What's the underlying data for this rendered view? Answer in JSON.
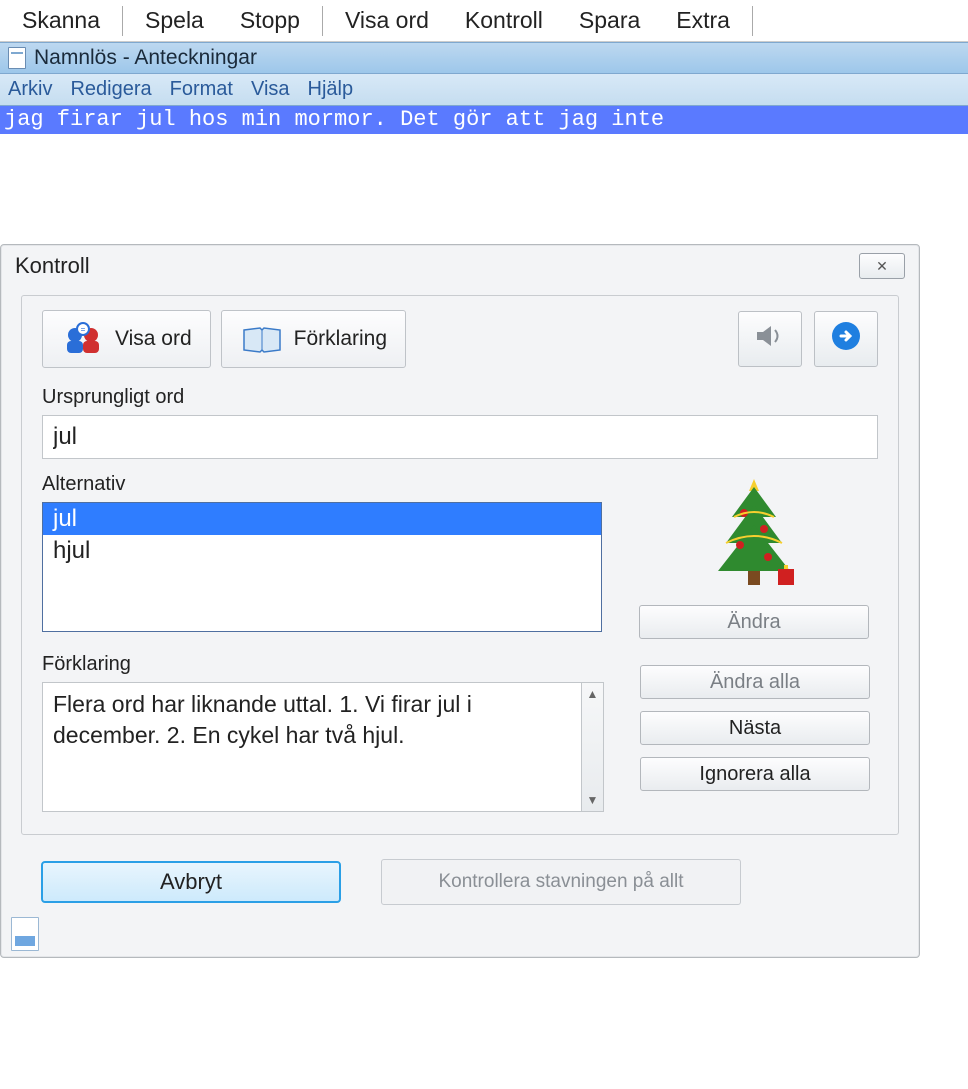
{
  "toolbar": [
    "Skanna",
    "Spela",
    "Stopp",
    "Visa ord",
    "Kontroll",
    "Spara",
    "Extra"
  ],
  "window_title": "Namnlös - Anteckningar",
  "menubar": [
    "Arkiv",
    "Redigera",
    "Format",
    "Visa",
    "Hjälp"
  ],
  "editor_text": "jag firar jul hos min mormor. Det gör att jag inte",
  "dialog": {
    "title": "Kontroll",
    "close_glyph": "✕",
    "tabs": {
      "show_word": "Visa ord",
      "explanation": "Förklaring"
    },
    "original_label": "Ursprungligt ord",
    "original_value": "jul",
    "alternatives_label": "Alternativ",
    "alternatives": [
      "jul",
      "hjul"
    ],
    "selected_alternative": 0,
    "buttons": {
      "change": "Ändra",
      "change_all": "Ändra alla",
      "next": "Nästa",
      "ignore_all": "Ignorera alla",
      "cancel": "Avbryt",
      "spellcheck_all": "Kontrollera stavningen på allt"
    },
    "explanation_label": "Förklaring",
    "explanation_text": "Flera ord har liknande uttal. 1. Vi firar jul i december. 2. En cykel har två hjul."
  }
}
